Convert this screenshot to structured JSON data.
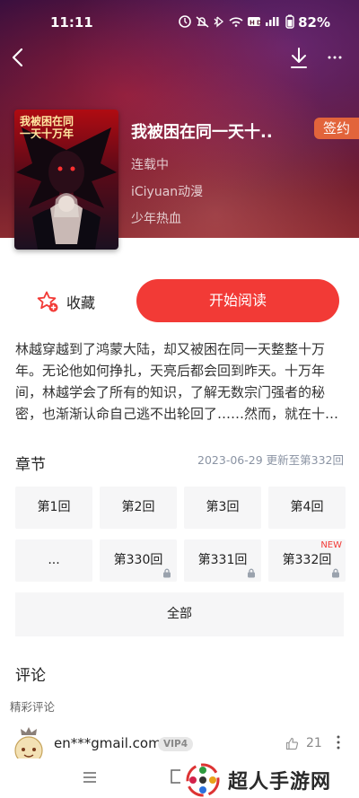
{
  "status_bar": {
    "time": "11:11",
    "battery": "82%"
  },
  "book": {
    "cover_title": "我被困在同一天十万年",
    "title": "我被困在同一天十..",
    "sign_badge": "签约",
    "status": "连载中",
    "publisher": "iCiyuan动漫",
    "genre": "少年热血"
  },
  "actions": {
    "favorite_label": "收藏",
    "read_label": "开始阅读"
  },
  "intro": "林越穿越到了鸿蒙大陆，却又被困在同一天整整十万年。无论他如何挣扎，天亮后都会回到昨天。十万年间，林越学会了所有的知识，了解无数宗门强者的秘密，也渐渐认命自己逃不出轮回了……然而，就在十…",
  "chapters": {
    "title": "章节",
    "update_info": "2023-06-29 更新至第332回",
    "items": [
      {
        "label": "第1回"
      },
      {
        "label": "第2回"
      },
      {
        "label": "第3回"
      },
      {
        "label": "第4回"
      },
      {
        "label": "..."
      },
      {
        "label": "第330回"
      },
      {
        "label": "第331回"
      },
      {
        "label": "第332回",
        "new_tag": "NEW"
      }
    ],
    "all_label": "全部"
  },
  "comments": {
    "title": "评论",
    "subtitle": "精彩评论",
    "items": [
      {
        "user": "en***gmail.com",
        "vip": "VIP4",
        "likes": "21"
      }
    ]
  },
  "watermark": {
    "text": "超人手游网"
  },
  "colors": {
    "accent": "#f23a36",
    "badge": "#e2643b"
  }
}
